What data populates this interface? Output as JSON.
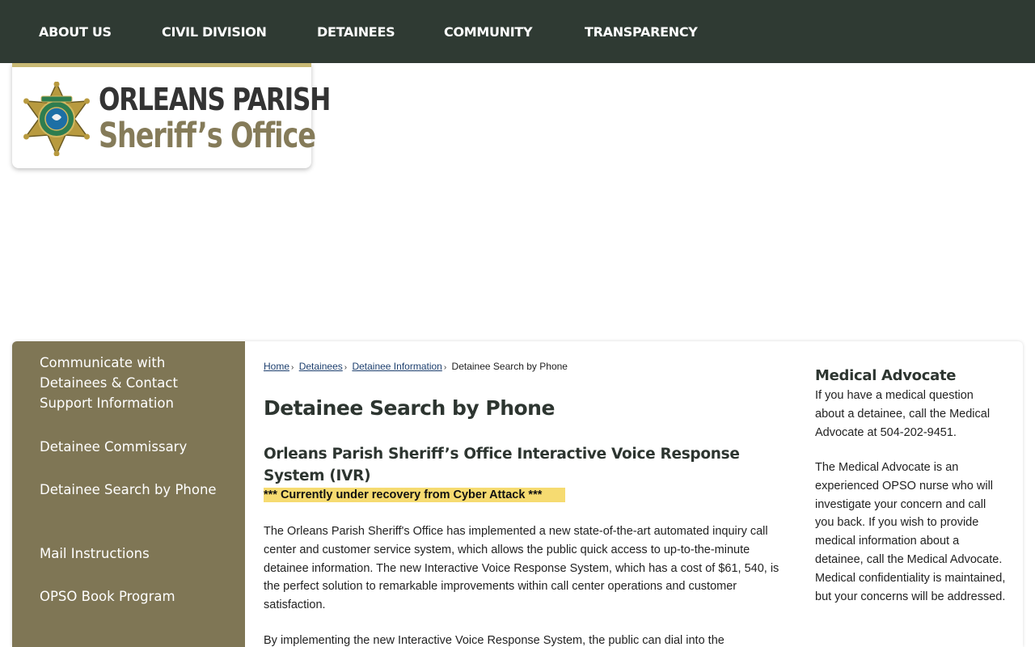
{
  "nav": {
    "items": [
      "ABOUT US",
      "CIVIL DIVISION",
      "DETAINEES",
      "COMMUNITY",
      "TRANSPARENCY"
    ]
  },
  "logo": {
    "line1": "ORLEANS PARISH",
    "line2": "Sheriff’s Office",
    "icon": "sheriff-star-badge-icon"
  },
  "sidebar": {
    "items": [
      "Communicate with Detainees & Contact Support Information",
      "Detainee Commissary",
      "Detainee Search by Phone",
      "Mail Instructions",
      "OPSO Book Program"
    ]
  },
  "breadcrumb": {
    "home": "Home",
    "detainees": " Detainees",
    "detainee_information": " Detainee Information",
    "current": "Detainee Search by Phone"
  },
  "main": {
    "title": "Detainee Search by Phone",
    "subtitle": "Orleans Parish Sheriff’s Office Interactive Voice Response System (IVR)",
    "alert": "*** Currently under recovery from Cyber Attack ***",
    "para1": "The Orleans Parish Sheriff's Office has implemented a new state-of-the-art automated inquiry call center and customer service system, which allows the public quick access to up-to-the-minute detainee information. The new Interactive Voice Response System, which has a cost of $61, 540, is the perfect solution to remarkable improvements within call center operations and customer satisfaction.",
    "para2": "By implementing the new Interactive Voice Response System, the public can dial into the"
  },
  "aside": {
    "title": "Medical Advocate",
    "para1": "If you have a medical question about a detainee, call the Medical Advocate at 504-202-9451.",
    "para2": "The Medical Advocate is an experienced OPSO nurse who will investigate your concern and call you back. If you wish to provide medical information about a detainee, call the Medical Advocate. Medical confidentiality is maintained, but your concerns will be addressed."
  },
  "colors": {
    "nav_bg": "#2f3a33",
    "sidebar_bg": "#7f7655",
    "accent_gold": "#c8b974",
    "alert_bg": "#f6db71",
    "link": "#1d3f6e"
  }
}
